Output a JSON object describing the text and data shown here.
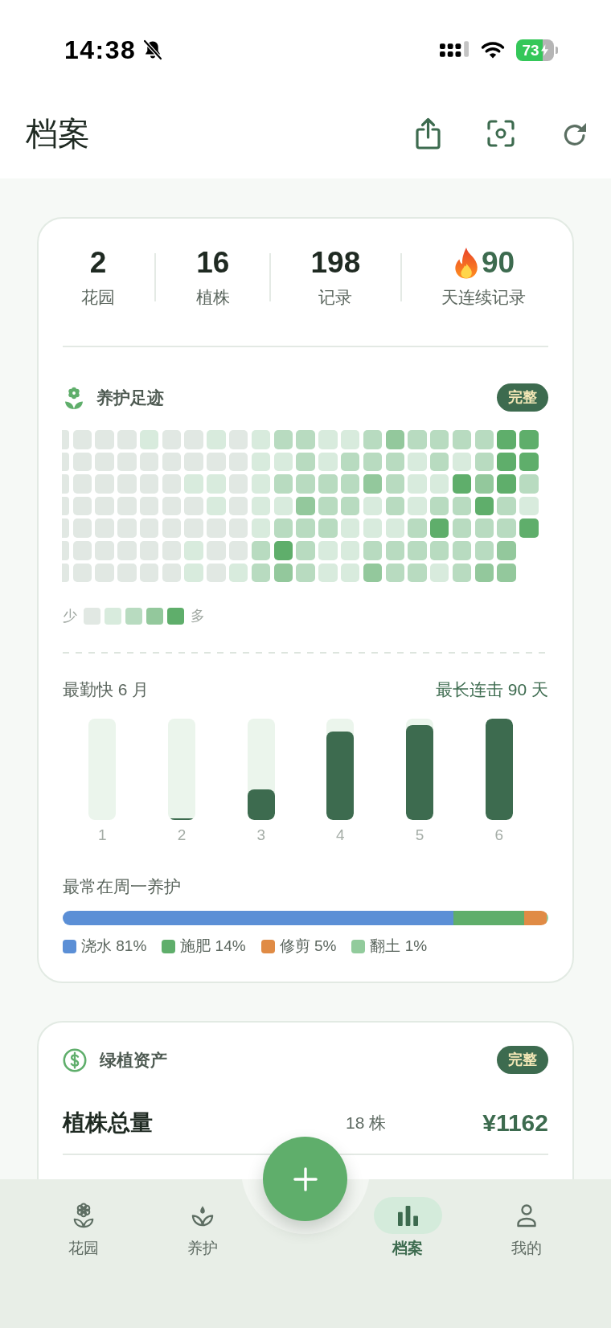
{
  "status_bar": {
    "time": "14:38",
    "battery": "73"
  },
  "header": {
    "title": "档案"
  },
  "stats": [
    {
      "kind": "count",
      "value": "2",
      "label": "花园"
    },
    {
      "kind": "count",
      "value": "16",
      "label": "植株"
    },
    {
      "kind": "count",
      "value": "198",
      "label": "记录"
    },
    {
      "kind": "streak",
      "value": "90",
      "label": "天连续记录"
    }
  ],
  "footprint": {
    "title": "养护足迹",
    "badge": "完整",
    "weeks": [
      {
        "days": [
          {
            "color": "#e1e8e3"
          },
          {
            "color": "#e1e8e3"
          },
          {
            "color": "#e1e8e3"
          },
          {
            "color": "#e1e8e3"
          },
          {
            "color": "#e1e8e3"
          },
          {
            "color": "#e1e8e3"
          },
          {
            "color": "#e1e8e3"
          }
        ]
      },
      {
        "days": [
          {
            "color": "#e1e8e3"
          },
          {
            "color": "#e1e8e3"
          },
          {
            "color": "#e1e8e3"
          },
          {
            "color": "#e1e8e3"
          },
          {
            "color": "#e1e8e3"
          },
          {
            "color": "#e1e8e3"
          },
          {
            "color": "#e1e8e3"
          }
        ]
      },
      {
        "days": [
          {
            "color": "#e1e8e3"
          },
          {
            "color": "#e1e8e3"
          },
          {
            "color": "#e1e8e3"
          },
          {
            "color": "#e1e8e3"
          },
          {
            "color": "#e1e8e3"
          },
          {
            "color": "#e1e8e3"
          },
          {
            "color": "#e1e8e3"
          }
        ]
      },
      {
        "days": [
          {
            "color": "#e1e8e3"
          },
          {
            "color": "#e1e8e3"
          },
          {
            "color": "#e1e8e3"
          },
          {
            "color": "#e1e8e3"
          },
          {
            "color": "#e1e8e3"
          },
          {
            "color": "#e1e8e3"
          },
          {
            "color": "#e1e8e3"
          }
        ]
      },
      {
        "days": [
          {
            "color": "#d8ebdd"
          },
          {
            "color": "#e1e8e3"
          },
          {
            "color": "#e1e8e3"
          },
          {
            "color": "#e1e8e3"
          },
          {
            "color": "#e1e8e3"
          },
          {
            "color": "#e1e8e3"
          },
          {
            "color": "#e1e8e3"
          }
        ]
      },
      {
        "days": [
          {
            "color": "#e1e8e3"
          },
          {
            "color": "#e1e8e3"
          },
          {
            "color": "#e1e8e3"
          },
          {
            "color": "#e1e8e3"
          },
          {
            "color": "#e1e8e3"
          },
          {
            "color": "#e1e8e3"
          },
          {
            "color": "#e1e8e3"
          }
        ]
      },
      {
        "days": [
          {
            "color": "#e1e8e3"
          },
          {
            "color": "#e1e8e3"
          },
          {
            "color": "#d8ebdd"
          },
          {
            "color": "#e1e8e3"
          },
          {
            "color": "#e1e8e3"
          },
          {
            "color": "#d8ebdd"
          },
          {
            "color": "#d8ebdd"
          }
        ]
      },
      {
        "days": [
          {
            "color": "#d8ebdd"
          },
          {
            "color": "#e1e8e3"
          },
          {
            "color": "#d8ebdd"
          },
          {
            "color": "#d8ebdd"
          },
          {
            "color": "#e1e8e3"
          },
          {
            "color": "#e1e8e3"
          },
          {
            "color": "#e1e8e3"
          }
        ]
      },
      {
        "days": [
          {
            "color": "#e1e8e3"
          },
          {
            "color": "#e1e8e3"
          },
          {
            "color": "#e1e8e3"
          },
          {
            "color": "#e1e8e3"
          },
          {
            "color": "#e1e8e3"
          },
          {
            "color": "#e1e8e3"
          },
          {
            "color": "#d8ebdd"
          }
        ]
      },
      {
        "days": [
          {
            "color": "#d8ebdd"
          },
          {
            "color": "#d8ebdd"
          },
          {
            "color": "#d8ebdd"
          },
          {
            "color": "#d8ebdd"
          },
          {
            "color": "#d8ebdd"
          },
          {
            "color": "#b8dbc0"
          },
          {
            "color": "#b8dbc0"
          }
        ]
      },
      {
        "days": [
          {
            "color": "#b8dbc0"
          },
          {
            "color": "#d8ebdd"
          },
          {
            "color": "#b8dbc0"
          },
          {
            "color": "#d8ebdd"
          },
          {
            "color": "#b8dbc0"
          },
          {
            "color": "#5fae6b"
          },
          {
            "color": "#93c89c"
          }
        ]
      },
      {
        "days": [
          {
            "color": "#b8dbc0"
          },
          {
            "color": "#b8dbc0"
          },
          {
            "color": "#b8dbc0"
          },
          {
            "color": "#93c89c"
          },
          {
            "color": "#b8dbc0"
          },
          {
            "color": "#b8dbc0"
          },
          {
            "color": "#b8dbc0"
          }
        ]
      },
      {
        "days": [
          {
            "color": "#d8ebdd"
          },
          {
            "color": "#d8ebdd"
          },
          {
            "color": "#b8dbc0"
          },
          {
            "color": "#b8dbc0"
          },
          {
            "color": "#b8dbc0"
          },
          {
            "color": "#d8ebdd"
          },
          {
            "color": "#d8ebdd"
          }
        ]
      },
      {
        "days": [
          {
            "color": "#d8ebdd"
          },
          {
            "color": "#b8dbc0"
          },
          {
            "color": "#b8dbc0"
          },
          {
            "color": "#b8dbc0"
          },
          {
            "color": "#d8ebdd"
          },
          {
            "color": "#d8ebdd"
          },
          {
            "color": "#d8ebdd"
          }
        ]
      },
      {
        "days": [
          {
            "color": "#b8dbc0"
          },
          {
            "color": "#b8dbc0"
          },
          {
            "color": "#93c89c"
          },
          {
            "color": "#d8ebdd"
          },
          {
            "color": "#d8ebdd"
          },
          {
            "color": "#b8dbc0"
          },
          {
            "color": "#93c89c"
          }
        ]
      },
      {
        "days": [
          {
            "color": "#93c89c"
          },
          {
            "color": "#b8dbc0"
          },
          {
            "color": "#b8dbc0"
          },
          {
            "color": "#b8dbc0"
          },
          {
            "color": "#d8ebdd"
          },
          {
            "color": "#b8dbc0"
          },
          {
            "color": "#b8dbc0"
          }
        ]
      },
      {
        "days": [
          {
            "color": "#b8dbc0"
          },
          {
            "color": "#d8ebdd"
          },
          {
            "color": "#d8ebdd"
          },
          {
            "color": "#d8ebdd"
          },
          {
            "color": "#b8dbc0"
          },
          {
            "color": "#b8dbc0"
          },
          {
            "color": "#b8dbc0"
          }
        ]
      },
      {
        "days": [
          {
            "color": "#b8dbc0"
          },
          {
            "color": "#b8dbc0"
          },
          {
            "color": "#d8ebdd"
          },
          {
            "color": "#b8dbc0"
          },
          {
            "color": "#5fae6b"
          },
          {
            "color": "#b8dbc0"
          },
          {
            "color": "#d8ebdd"
          }
        ]
      },
      {
        "days": [
          {
            "color": "#b8dbc0"
          },
          {
            "color": "#d8ebdd"
          },
          {
            "color": "#5fae6b"
          },
          {
            "color": "#b8dbc0"
          },
          {
            "color": "#b8dbc0"
          },
          {
            "color": "#b8dbc0"
          },
          {
            "color": "#b8dbc0"
          }
        ]
      },
      {
        "days": [
          {
            "color": "#b8dbc0"
          },
          {
            "color": "#b8dbc0"
          },
          {
            "color": "#93c89c"
          },
          {
            "color": "#5fae6b"
          },
          {
            "color": "#b8dbc0"
          },
          {
            "color": "#b8dbc0"
          },
          {
            "color": "#93c89c"
          }
        ]
      },
      {
        "days": [
          {
            "color": "#5fae6b"
          },
          {
            "color": "#5fae6b"
          },
          {
            "color": "#5fae6b"
          },
          {
            "color": "#b8dbc0"
          },
          {
            "color": "#b8dbc0"
          },
          {
            "color": "#93c89c"
          },
          {
            "color": "#93c89c"
          }
        ]
      },
      {
        "days": [
          {
            "color": "#5fae6b"
          },
          {
            "color": "#5fae6b"
          },
          {
            "color": "#b8dbc0"
          },
          {
            "color": "#d8ebdd"
          },
          {
            "color": "#5fae6b"
          }
        ]
      }
    ],
    "legend": {
      "less": "少",
      "more": "多",
      "swatches": [
        {
          "color": "#e1e8e3"
        },
        {
          "color": "#d8ebdd"
        },
        {
          "color": "#b8dbc0"
        },
        {
          "color": "#93c89c"
        },
        {
          "color": "#5fae6b"
        }
      ]
    }
  },
  "monthly": {
    "most_active": "最勤快 6 月",
    "longest_streak": "最长连击 90 天",
    "months": [
      {
        "label": "1"
      },
      {
        "label": "2"
      },
      {
        "label": "3"
      },
      {
        "label": "4"
      },
      {
        "label": "5"
      },
      {
        "label": "6"
      }
    ]
  },
  "weekday": {
    "title": "最常在周一养护",
    "legend": [
      {
        "label": "浇水 81%",
        "color": "#5b8fd6"
      },
      {
        "label": "施肥 14%",
        "color": "#5fae6b"
      },
      {
        "label": "修剪 5%",
        "color": "#e08b45"
      },
      {
        "label": "翻土 1%",
        "color": "#92cb9c"
      }
    ]
  },
  "assets": {
    "title": "绿植资产",
    "badge": "完整",
    "rows": [
      {
        "name": "植株总量",
        "count": "18 株",
        "value": "¥1162"
      }
    ]
  },
  "nav": {
    "items": [
      {
        "label": "花园",
        "selected": false
      },
      {
        "label": "养护",
        "selected": false
      },
      {
        "label": "档案",
        "selected": true
      },
      {
        "label": "我的",
        "selected": false
      }
    ]
  }
}
